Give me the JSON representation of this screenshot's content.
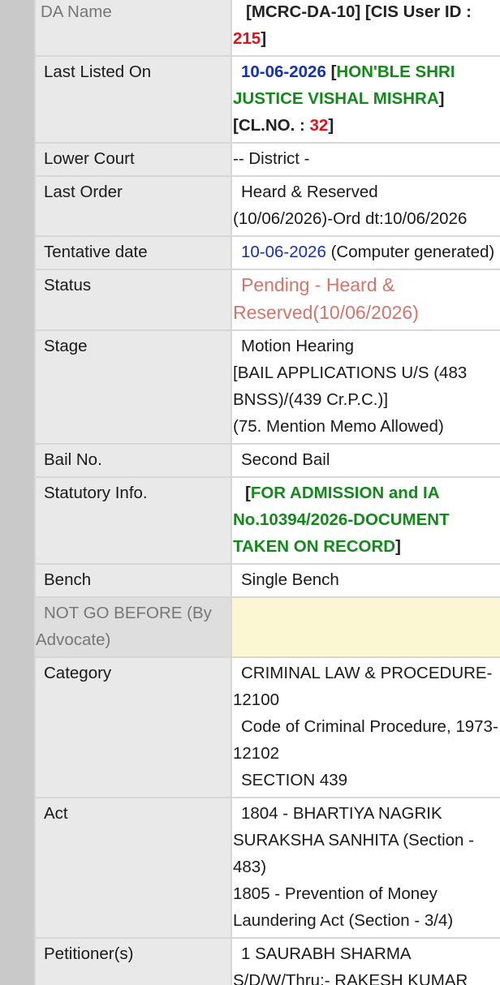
{
  "rows": {
    "da_name": {
      "label": "DA Name",
      "code": "[MCRC-DA-10]",
      "cis_prefix": " [CIS User ID : ",
      "cis_id": "215",
      "cis_suffix": "]"
    },
    "last_listed": {
      "label": "Last Listed On",
      "date": "10-06-2026",
      "bracket_open": " [",
      "judge": "HON'BLE SHRI JUSTICE VISHAL MISHRA",
      "bracket_close": "]",
      "cl_prefix": "[CL.NO. : ",
      "cl_no": "32",
      "cl_suffix": "]"
    },
    "lower_court": {
      "label": "Lower Court",
      "value": "-- District -"
    },
    "last_order": {
      "label": "Last Order",
      "value_1": "Heard & Reserved",
      "value_2": "(10/06/2026)-Ord dt:10/06/2026"
    },
    "tentative": {
      "label": "Tentative date",
      "date": "10-06-2026",
      "note": " (Computer generated)"
    },
    "status": {
      "label": "Status",
      "value_1": "Pending - Heard &",
      "value_2": "Reserved(10/06/2026)"
    },
    "stage": {
      "label": "Stage",
      "value_1": "Motion Hearing",
      "value_2": "[BAIL APPLICATIONS U/S (483 BNSS)/(439 Cr.P.C.)]",
      "value_3": "(75. Mention Memo Allowed)"
    },
    "bail_no": {
      "label": "Bail No.",
      "value": "Second Bail"
    },
    "statutory": {
      "label": "Statutory Info.",
      "bracket_open": "[",
      "value": "FOR ADMISSION and IA No.10394/2026-DOCUMENT TAKEN ON RECORD",
      "bracket_close": "]"
    },
    "bench": {
      "label": "Bench",
      "value": "Single Bench"
    },
    "not_go_before": {
      "label": "NOT GO BEFORE (By Advocate)",
      "value": ""
    },
    "category": {
      "label": "Category",
      "value_1": "CRIMINAL LAW & PROCEDURE-12100",
      "value_2": "Code of Criminal Procedure, 1973-12102",
      "value_3": "SECTION 439"
    },
    "act": {
      "label": "Act",
      "value_1": "1804 - BHARTIYA NAGRIK SURAKSHA SANHITA (Section - 483)",
      "value_2": "1805 - Prevention of Money Laundering Act (Section - 3/4)"
    },
    "petitioner": {
      "label": "Petitioner(s)",
      "value_1": "1 SAURABH SHARMA",
      "value_2": "S/D/W/Thru:- RAKESH KUMAR"
    }
  },
  "colors": {
    "blue": "#1530b0",
    "green": "#15881d",
    "red": "#e0121b",
    "status": "#d4756b",
    "highlight": "#faf7d2"
  }
}
